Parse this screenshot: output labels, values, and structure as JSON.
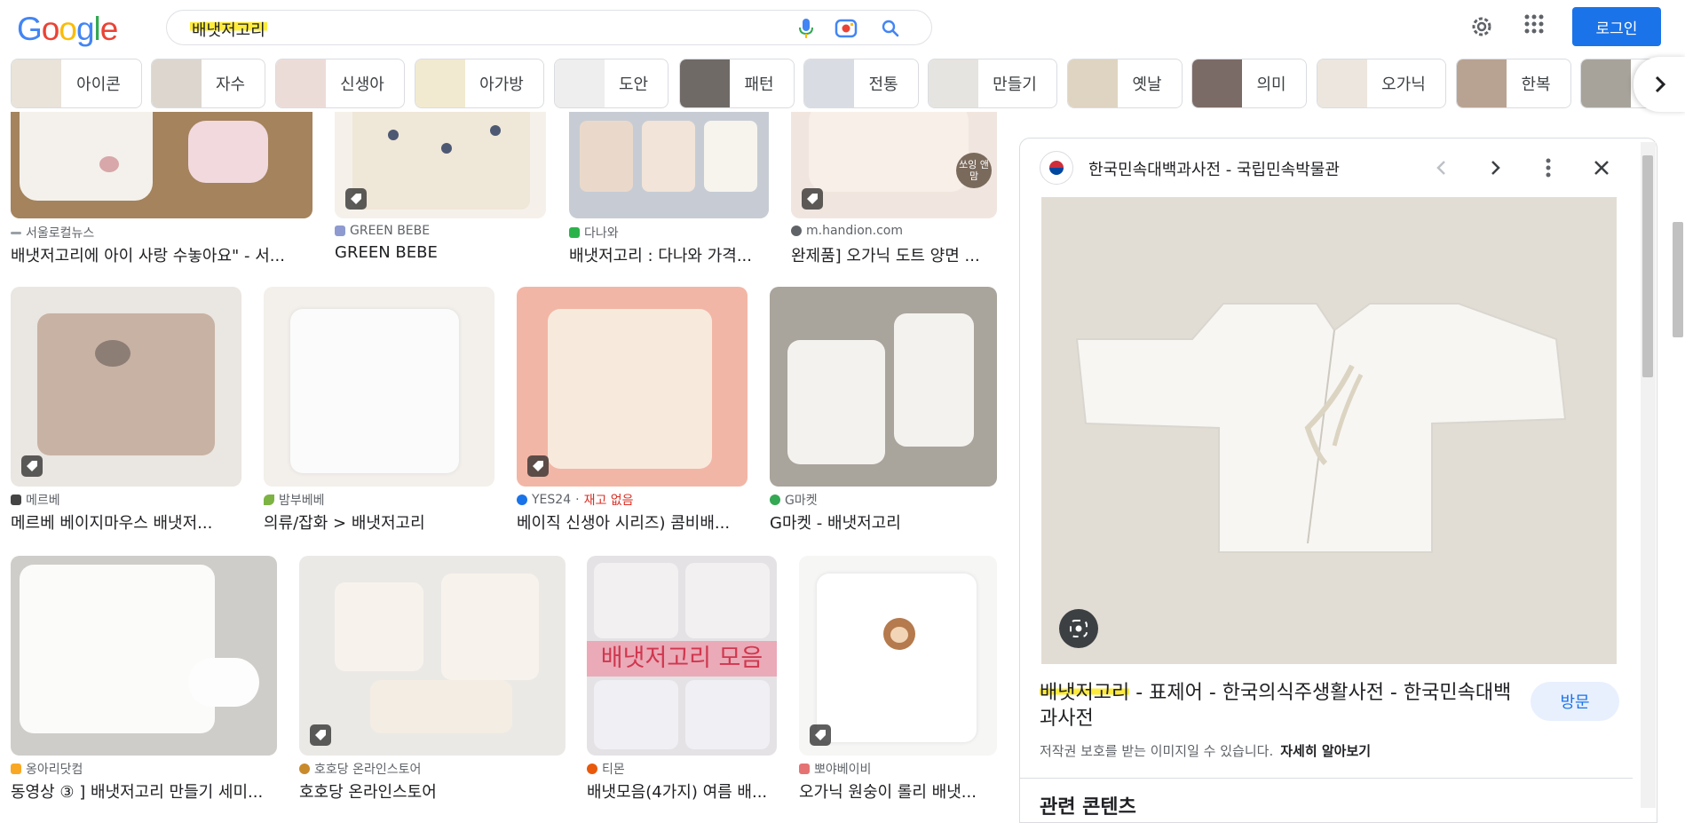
{
  "header": {
    "logo": "Google",
    "search_query": "배냇저고리",
    "login_label": "로그인"
  },
  "chips": [
    {
      "label": "아이콘",
      "color": "#e9e3da"
    },
    {
      "label": "자수",
      "color": "#dcd6cf"
    },
    {
      "label": "신생아",
      "color": "#ecdcd8"
    },
    {
      "label": "아가방",
      "color": "#f2ead0"
    },
    {
      "label": "도안",
      "color": "#eeeeee"
    },
    {
      "label": "패턴",
      "color": "#6f6a66"
    },
    {
      "label": "전통",
      "color": "#d9dde3"
    },
    {
      "label": "만들기",
      "color": "#e6e4e0"
    },
    {
      "label": "옛날",
      "color": "#dfd4c1"
    },
    {
      "label": "의미",
      "color": "#7b6b66"
    },
    {
      "label": "오가닉",
      "color": "#ece6df"
    },
    {
      "label": "한복",
      "color": "#b8a392"
    },
    {
      "label": "",
      "color": "#a7a39b"
    }
  ],
  "results": [
    {
      "source": "서울로컬뉴스",
      "title": "배냇저고리에 아이 사랑 수놓아요\" - 서...",
      "stock": "",
      "src_color": "#5f6368"
    },
    {
      "source": "GREEN BEBE",
      "title": "GREEN BEBE",
      "stock": "",
      "src_color": "#8e9ad0"
    },
    {
      "source": "다나와",
      "title": "배냇저고리 : 다나와 가격...",
      "stock": "",
      "src_color": "#2bb34a"
    },
    {
      "source": "m.handion.com",
      "title": "완제품] 오가닉 도트 양면 ...",
      "stock": "",
      "src_color": "#5f6368"
    },
    {
      "source": "메르베",
      "title": "메르베 베이지마우스 배냇저...",
      "stock": "",
      "src_color": "#444444"
    },
    {
      "source": "밤부베베",
      "title": "의류/잡화 > 배냇저고리",
      "stock": "",
      "src_color": "#7cb342"
    },
    {
      "source": "YES24",
      "title": "베이직 신생아 시리즈) 콤비배...",
      "stock": "재고 없음",
      "src_color": "#1a73e8"
    },
    {
      "source": "G마켓",
      "title": "G마켓 - 배냇저고리",
      "stock": "",
      "src_color": "#34a853"
    },
    {
      "source": "옹아리닷컴",
      "title": "동영상 ③ ] 배냇저고리 만들기 세미...",
      "stock": "",
      "src_color": "#f9a825"
    },
    {
      "source": "호호당 온라인스토어",
      "title": "호호당 온라인스토어",
      "stock": "",
      "src_color": "#c98a2c"
    },
    {
      "source": "티몬",
      "title": "배냇모음(4가지) 여름 배...",
      "stock": "",
      "src_color": "#e8590c"
    },
    {
      "source": "뽀야베이비",
      "title": "오가닉 원숭이 롤리 배냇...",
      "stock": "",
      "src_color": "#e57373"
    }
  ],
  "overlays": {
    "collage_text": "배냇저고리 모음",
    "badge_text": "쏘잉 앤맘"
  },
  "panel": {
    "site_name": "한국민속대백과사전 - 국립민속박물관",
    "title_highlight": "배냇저고리",
    "title_rest": " - 표제어 - 한국의식주생활사전 - 한국민속대백과사전",
    "visit_label": "방문",
    "copyright_text": "저작권 보호를 받는 이미지일 수 있습니다.",
    "learn_more": "자세히 알아보기",
    "related_heading": "관련 콘텐츠"
  }
}
